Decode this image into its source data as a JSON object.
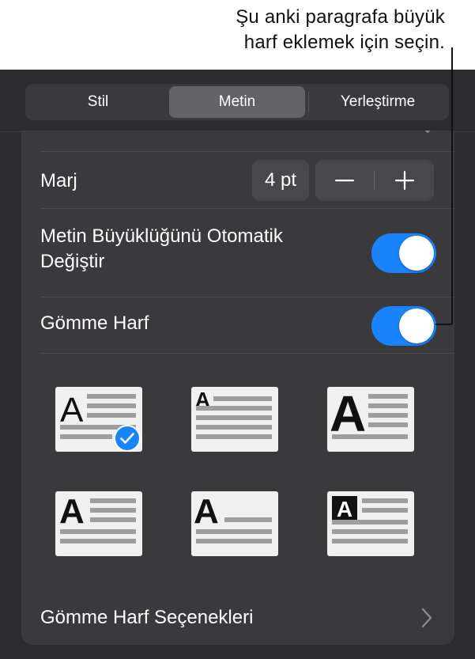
{
  "callout": {
    "line1": "Şu anki paragrafa büyük",
    "line2": "harf eklemek için seçin."
  },
  "tabs": [
    {
      "label": "Stil",
      "active": false
    },
    {
      "label": "Metin",
      "active": true
    },
    {
      "label": "Yerleştirme",
      "active": false
    }
  ],
  "margin": {
    "label": "Marj",
    "value": "4 pt",
    "decrement_icon": "minus-icon",
    "increment_icon": "plus-icon"
  },
  "autosize": {
    "label_line1": "Metin Büyüklüğünü Otomatik",
    "label_line2": "Değiştir",
    "on": true
  },
  "dropcap": {
    "label": "Gömme Harf",
    "on": true
  },
  "dropcap_styles": [
    {
      "letter": "A",
      "selected": true
    },
    {
      "letter": "A",
      "selected": false
    },
    {
      "letter": "A",
      "selected": false
    },
    {
      "letter": "A",
      "selected": false
    },
    {
      "letter": "A",
      "selected": false
    },
    {
      "letter": "A",
      "selected": false
    }
  ],
  "options_link": {
    "label": "Gömme Harf Seçenekleri",
    "icon": "chevron-right-icon"
  },
  "colors": {
    "panel": "#2c2c2e",
    "card": "#3a3a3c",
    "accent": "#1a84ff",
    "tile": "#f0f0f0"
  }
}
